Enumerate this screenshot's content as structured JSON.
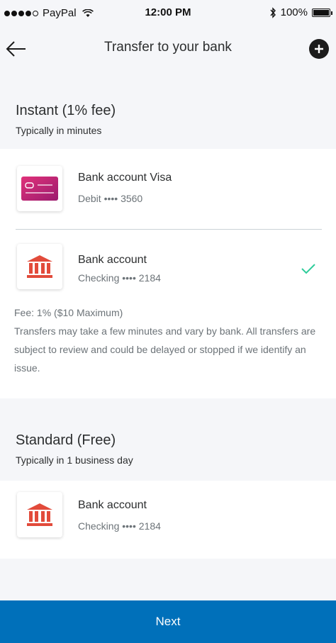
{
  "status_bar": {
    "carrier": "PayPal",
    "time": "12:00 PM",
    "battery": "100%"
  },
  "header": {
    "title": "Transfer to your bank",
    "back_icon": "arrow-left-icon",
    "add_icon": "plus-circle-icon"
  },
  "instant": {
    "title": "Instant (1% fee)",
    "subtitle": "Typically in minutes",
    "accounts": [
      {
        "name": "Bank account Visa",
        "detail": "Debit •••• 3560",
        "icon": "debit-card-icon",
        "selected": false
      },
      {
        "name": "Bank account",
        "detail": "Checking •••• 2184",
        "icon": "bank-icon",
        "selected": true
      }
    ],
    "fee_line": "Fee: 1% ($10 Maximum)",
    "notice": "Transfers may take a few minutes and vary by bank. All transfers are subject to review and could be delayed or stopped if we identify an issue."
  },
  "standard": {
    "title": "Standard (Free)",
    "subtitle": "Typically in 1 business day",
    "accounts": [
      {
        "name": "Bank account",
        "detail": "Checking •••• 2184",
        "icon": "bank-icon",
        "selected": false
      }
    ]
  },
  "footer": {
    "next_label": "Next"
  },
  "colors": {
    "brand_blue": "#0070ba",
    "check_green": "#2ecc9a",
    "card_pink": "#c2185b",
    "bank_red": "#e24b3b"
  }
}
